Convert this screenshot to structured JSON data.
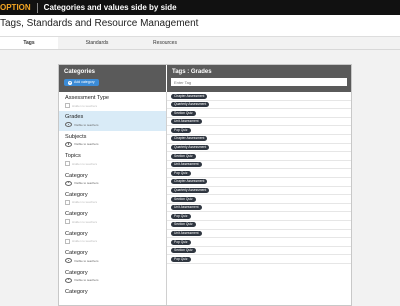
{
  "app": {
    "option_label": "OPTION",
    "title": "Categories and values side by side"
  },
  "header": {
    "title": "Tags, Standards and Resource Management"
  },
  "tabs": [
    {
      "label": "Tags"
    },
    {
      "label": "Standards"
    },
    {
      "label": "Resources"
    }
  ],
  "categories_panel": {
    "title": "Categories",
    "add_label": "Add category"
  },
  "values_panel": {
    "title": "Tags : Grades",
    "input_placeholder": "Enter Tag"
  },
  "categories": [
    {
      "name": "Assessment Type",
      "visibility": "Hidden to teachers"
    },
    {
      "name": "Grades",
      "visibility": "Visible to teachers"
    },
    {
      "name": "Subjects",
      "visibility": "Visible to teachers"
    },
    {
      "name": "Topics",
      "visibility": "Hidden to teachers"
    },
    {
      "name": "Category",
      "visibility": "Visible to teachers"
    },
    {
      "name": "Category",
      "visibility": "Hidden to teachers"
    },
    {
      "name": "Category",
      "visibility": "Hidden to teachers"
    },
    {
      "name": "Category",
      "visibility": "Hidden to teachers"
    },
    {
      "name": "Category",
      "visibility": "Visible to teachers"
    },
    {
      "name": "Category",
      "visibility": "Visible to teachers"
    },
    {
      "name": "Category",
      "visibility": ""
    }
  ],
  "values": [
    "Chapter Assessment",
    "Quarterly Assessment",
    "Section Quiz",
    "Unit Assessment",
    "Pop Quiz",
    "Chapter Assessment",
    "Quarterly Assessment",
    "Section Quiz",
    "Unit Assessment",
    "Pop Quiz",
    "Chapter Assessment",
    "Quarterly Assessment",
    "Section Quiz",
    "Unit Assessment",
    "Pop Quiz",
    "Section Quiz",
    "Unit Assessment",
    "Pop Quiz",
    "Section Quiz",
    "Pop Quiz"
  ]
}
